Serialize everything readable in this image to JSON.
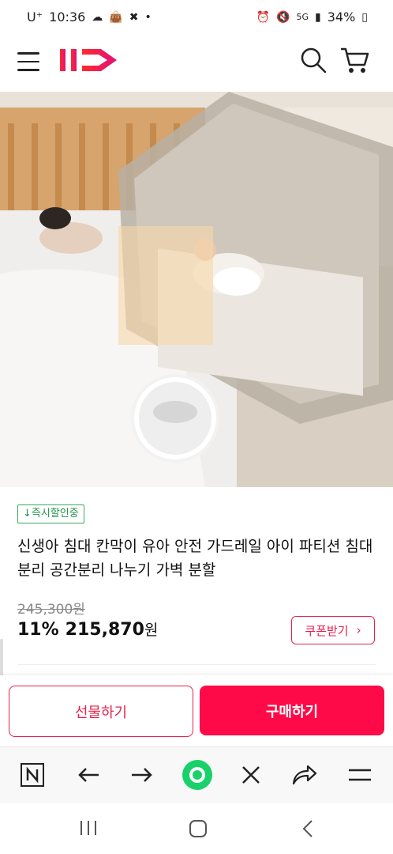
{
  "status": {
    "carrier": "U⁺",
    "time": "10:36",
    "network": "5G",
    "battery": "34%"
  },
  "product": {
    "badge": "↓즉시할인중",
    "title": "신생아 침대 칸막이 유아 안전 가드레일 아이 파티션 침대분리 공간분리 나누기 가벽 분할",
    "original_price": "245,300원",
    "discount": "11%",
    "price": "215,870",
    "currency": "원",
    "coupon_label": "쿠폰받기"
  },
  "actions": {
    "gift": "선물하기",
    "buy": "구매하기"
  },
  "colors": {
    "brand": "#ff0a48",
    "accent": "#e4234b",
    "badge": "#39a95b"
  }
}
